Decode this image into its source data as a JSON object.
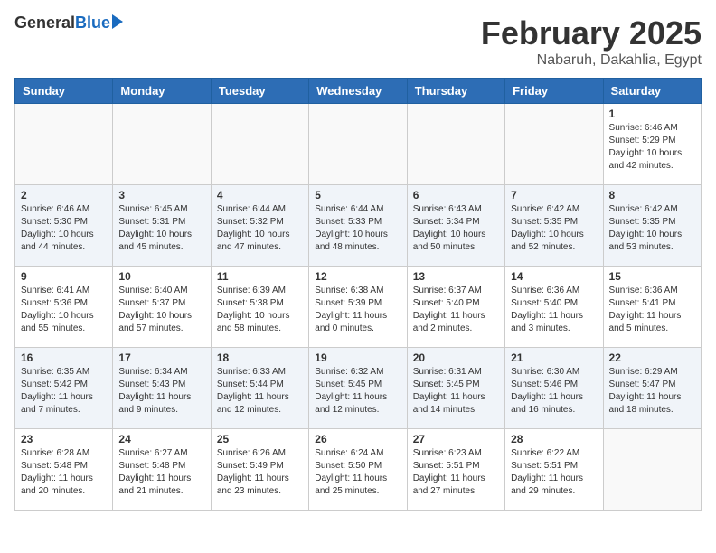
{
  "header": {
    "logo_general": "General",
    "logo_blue": "Blue",
    "month_title": "February 2025",
    "location": "Nabaruh, Dakahlia, Egypt"
  },
  "days_of_week": [
    "Sunday",
    "Monday",
    "Tuesday",
    "Wednesday",
    "Thursday",
    "Friday",
    "Saturday"
  ],
  "weeks": [
    {
      "alt": false,
      "days": [
        {
          "num": "",
          "info": ""
        },
        {
          "num": "",
          "info": ""
        },
        {
          "num": "",
          "info": ""
        },
        {
          "num": "",
          "info": ""
        },
        {
          "num": "",
          "info": ""
        },
        {
          "num": "",
          "info": ""
        },
        {
          "num": "1",
          "info": "Sunrise: 6:46 AM\nSunset: 5:29 PM\nDaylight: 10 hours and 42 minutes."
        }
      ]
    },
    {
      "alt": true,
      "days": [
        {
          "num": "2",
          "info": "Sunrise: 6:46 AM\nSunset: 5:30 PM\nDaylight: 10 hours and 44 minutes."
        },
        {
          "num": "3",
          "info": "Sunrise: 6:45 AM\nSunset: 5:31 PM\nDaylight: 10 hours and 45 minutes."
        },
        {
          "num": "4",
          "info": "Sunrise: 6:44 AM\nSunset: 5:32 PM\nDaylight: 10 hours and 47 minutes."
        },
        {
          "num": "5",
          "info": "Sunrise: 6:44 AM\nSunset: 5:33 PM\nDaylight: 10 hours and 48 minutes."
        },
        {
          "num": "6",
          "info": "Sunrise: 6:43 AM\nSunset: 5:34 PM\nDaylight: 10 hours and 50 minutes."
        },
        {
          "num": "7",
          "info": "Sunrise: 6:42 AM\nSunset: 5:35 PM\nDaylight: 10 hours and 52 minutes."
        },
        {
          "num": "8",
          "info": "Sunrise: 6:42 AM\nSunset: 5:35 PM\nDaylight: 10 hours and 53 minutes."
        }
      ]
    },
    {
      "alt": false,
      "days": [
        {
          "num": "9",
          "info": "Sunrise: 6:41 AM\nSunset: 5:36 PM\nDaylight: 10 hours and 55 minutes."
        },
        {
          "num": "10",
          "info": "Sunrise: 6:40 AM\nSunset: 5:37 PM\nDaylight: 10 hours and 57 minutes."
        },
        {
          "num": "11",
          "info": "Sunrise: 6:39 AM\nSunset: 5:38 PM\nDaylight: 10 hours and 58 minutes."
        },
        {
          "num": "12",
          "info": "Sunrise: 6:38 AM\nSunset: 5:39 PM\nDaylight: 11 hours and 0 minutes."
        },
        {
          "num": "13",
          "info": "Sunrise: 6:37 AM\nSunset: 5:40 PM\nDaylight: 11 hours and 2 minutes."
        },
        {
          "num": "14",
          "info": "Sunrise: 6:36 AM\nSunset: 5:40 PM\nDaylight: 11 hours and 3 minutes."
        },
        {
          "num": "15",
          "info": "Sunrise: 6:36 AM\nSunset: 5:41 PM\nDaylight: 11 hours and 5 minutes."
        }
      ]
    },
    {
      "alt": true,
      "days": [
        {
          "num": "16",
          "info": "Sunrise: 6:35 AM\nSunset: 5:42 PM\nDaylight: 11 hours and 7 minutes."
        },
        {
          "num": "17",
          "info": "Sunrise: 6:34 AM\nSunset: 5:43 PM\nDaylight: 11 hours and 9 minutes."
        },
        {
          "num": "18",
          "info": "Sunrise: 6:33 AM\nSunset: 5:44 PM\nDaylight: 11 hours and 12 minutes."
        },
        {
          "num": "19",
          "info": "Sunrise: 6:32 AM\nSunset: 5:45 PM\nDaylight: 11 hours and 12 minutes."
        },
        {
          "num": "20",
          "info": "Sunrise: 6:31 AM\nSunset: 5:45 PM\nDaylight: 11 hours and 14 minutes."
        },
        {
          "num": "21",
          "info": "Sunrise: 6:30 AM\nSunset: 5:46 PM\nDaylight: 11 hours and 16 minutes."
        },
        {
          "num": "22",
          "info": "Sunrise: 6:29 AM\nSunset: 5:47 PM\nDaylight: 11 hours and 18 minutes."
        }
      ]
    },
    {
      "alt": false,
      "days": [
        {
          "num": "23",
          "info": "Sunrise: 6:28 AM\nSunset: 5:48 PM\nDaylight: 11 hours and 20 minutes."
        },
        {
          "num": "24",
          "info": "Sunrise: 6:27 AM\nSunset: 5:48 PM\nDaylight: 11 hours and 21 minutes."
        },
        {
          "num": "25",
          "info": "Sunrise: 6:26 AM\nSunset: 5:49 PM\nDaylight: 11 hours and 23 minutes."
        },
        {
          "num": "26",
          "info": "Sunrise: 6:24 AM\nSunset: 5:50 PM\nDaylight: 11 hours and 25 minutes."
        },
        {
          "num": "27",
          "info": "Sunrise: 6:23 AM\nSunset: 5:51 PM\nDaylight: 11 hours and 27 minutes."
        },
        {
          "num": "28",
          "info": "Sunrise: 6:22 AM\nSunset: 5:51 PM\nDaylight: 11 hours and 29 minutes."
        },
        {
          "num": "",
          "info": ""
        }
      ]
    }
  ]
}
